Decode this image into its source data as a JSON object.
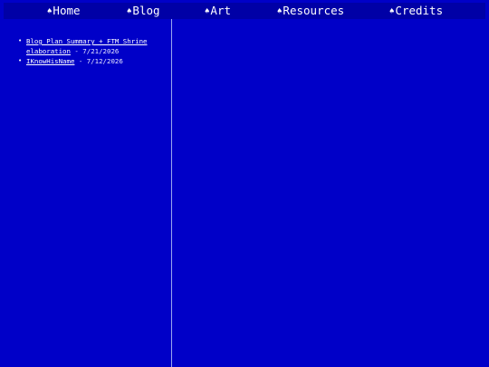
{
  "nav": {
    "items": [
      {
        "icon": "♠",
        "label": "Home"
      },
      {
        "icon": "♠",
        "label": "Blog"
      },
      {
        "icon": "♠",
        "label": "Art"
      },
      {
        "icon": "♠",
        "label": "Resources"
      },
      {
        "icon": "♠",
        "label": "Credits"
      }
    ]
  },
  "sidebar": {
    "posts": [
      {
        "title": "Blog Plan Summary + FTM Shrine elaboration",
        "date": " - 7/21/2026"
      },
      {
        "title": "IKnowHisName",
        "date": " - 7/12/2026"
      }
    ]
  },
  "colors": {
    "background": "#0000c8",
    "nav_background": "#0000a6",
    "divider": "#9aa6f0",
    "text": "#ffffff"
  }
}
